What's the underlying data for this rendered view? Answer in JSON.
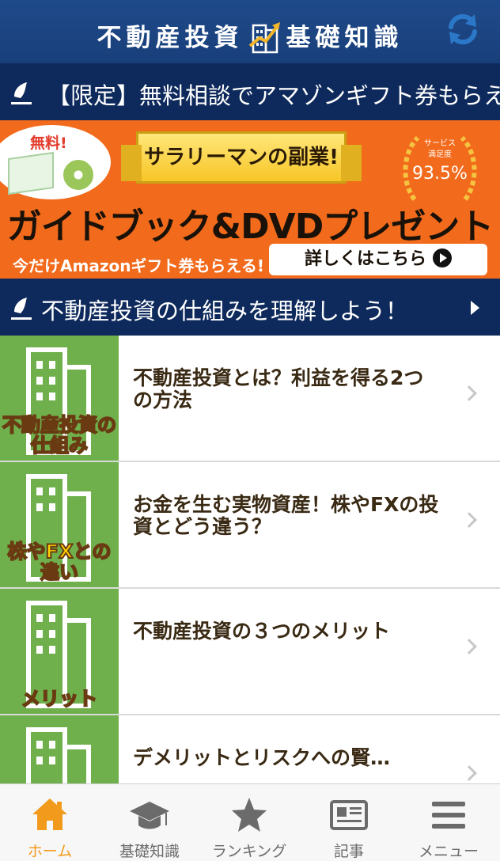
{
  "header": {
    "title_left": "不動産投資",
    "title_right": "基礎知識",
    "refresh_icon": "refresh-icon"
  },
  "ticker": {
    "text": "【限定】無料相談でアマゾンギフト券もらえる"
  },
  "banner": {
    "free_label": "無料!",
    "ribbon": "サラリーマンの副業!",
    "badge_line1": "サービス",
    "badge_line2": "満足度",
    "badge_value": "93.5%",
    "headline": "ガイドブック&DVDプレゼント",
    "sub": "今だけAmazonギフト券もらえる!",
    "cta": "詳しくはこちら"
  },
  "section": {
    "title": "不動産投資の仕組みを理解しよう！"
  },
  "articles": [
    {
      "thumb_label": "不動産投資の仕組み",
      "title": "不動産投資とは？利益を得る2つの方法"
    },
    {
      "thumb_label": "株やFXとの違い",
      "title": "お金を生む実物資産！株やFXの投資とどう違う？"
    },
    {
      "thumb_label": "メリット",
      "title": "不動産投資の３つのメリット"
    },
    {
      "thumb_label": "",
      "title": "デメリットとリスクへの賢…"
    }
  ],
  "tabs": [
    {
      "label": "ホーム",
      "icon": "home-icon",
      "active": true
    },
    {
      "label": "基礎知識",
      "icon": "graduation-cap-icon",
      "active": false
    },
    {
      "label": "ランキング",
      "icon": "star-icon",
      "active": false
    },
    {
      "label": "記事",
      "icon": "newspaper-icon",
      "active": false
    },
    {
      "label": "メニュー",
      "icon": "menu-icon",
      "active": false
    }
  ],
  "colors": {
    "header": "#1f4a8a",
    "nav_dark": "#0e2a5c",
    "banner_orange": "#f26a1b",
    "accent": "#f29a1c"
  }
}
